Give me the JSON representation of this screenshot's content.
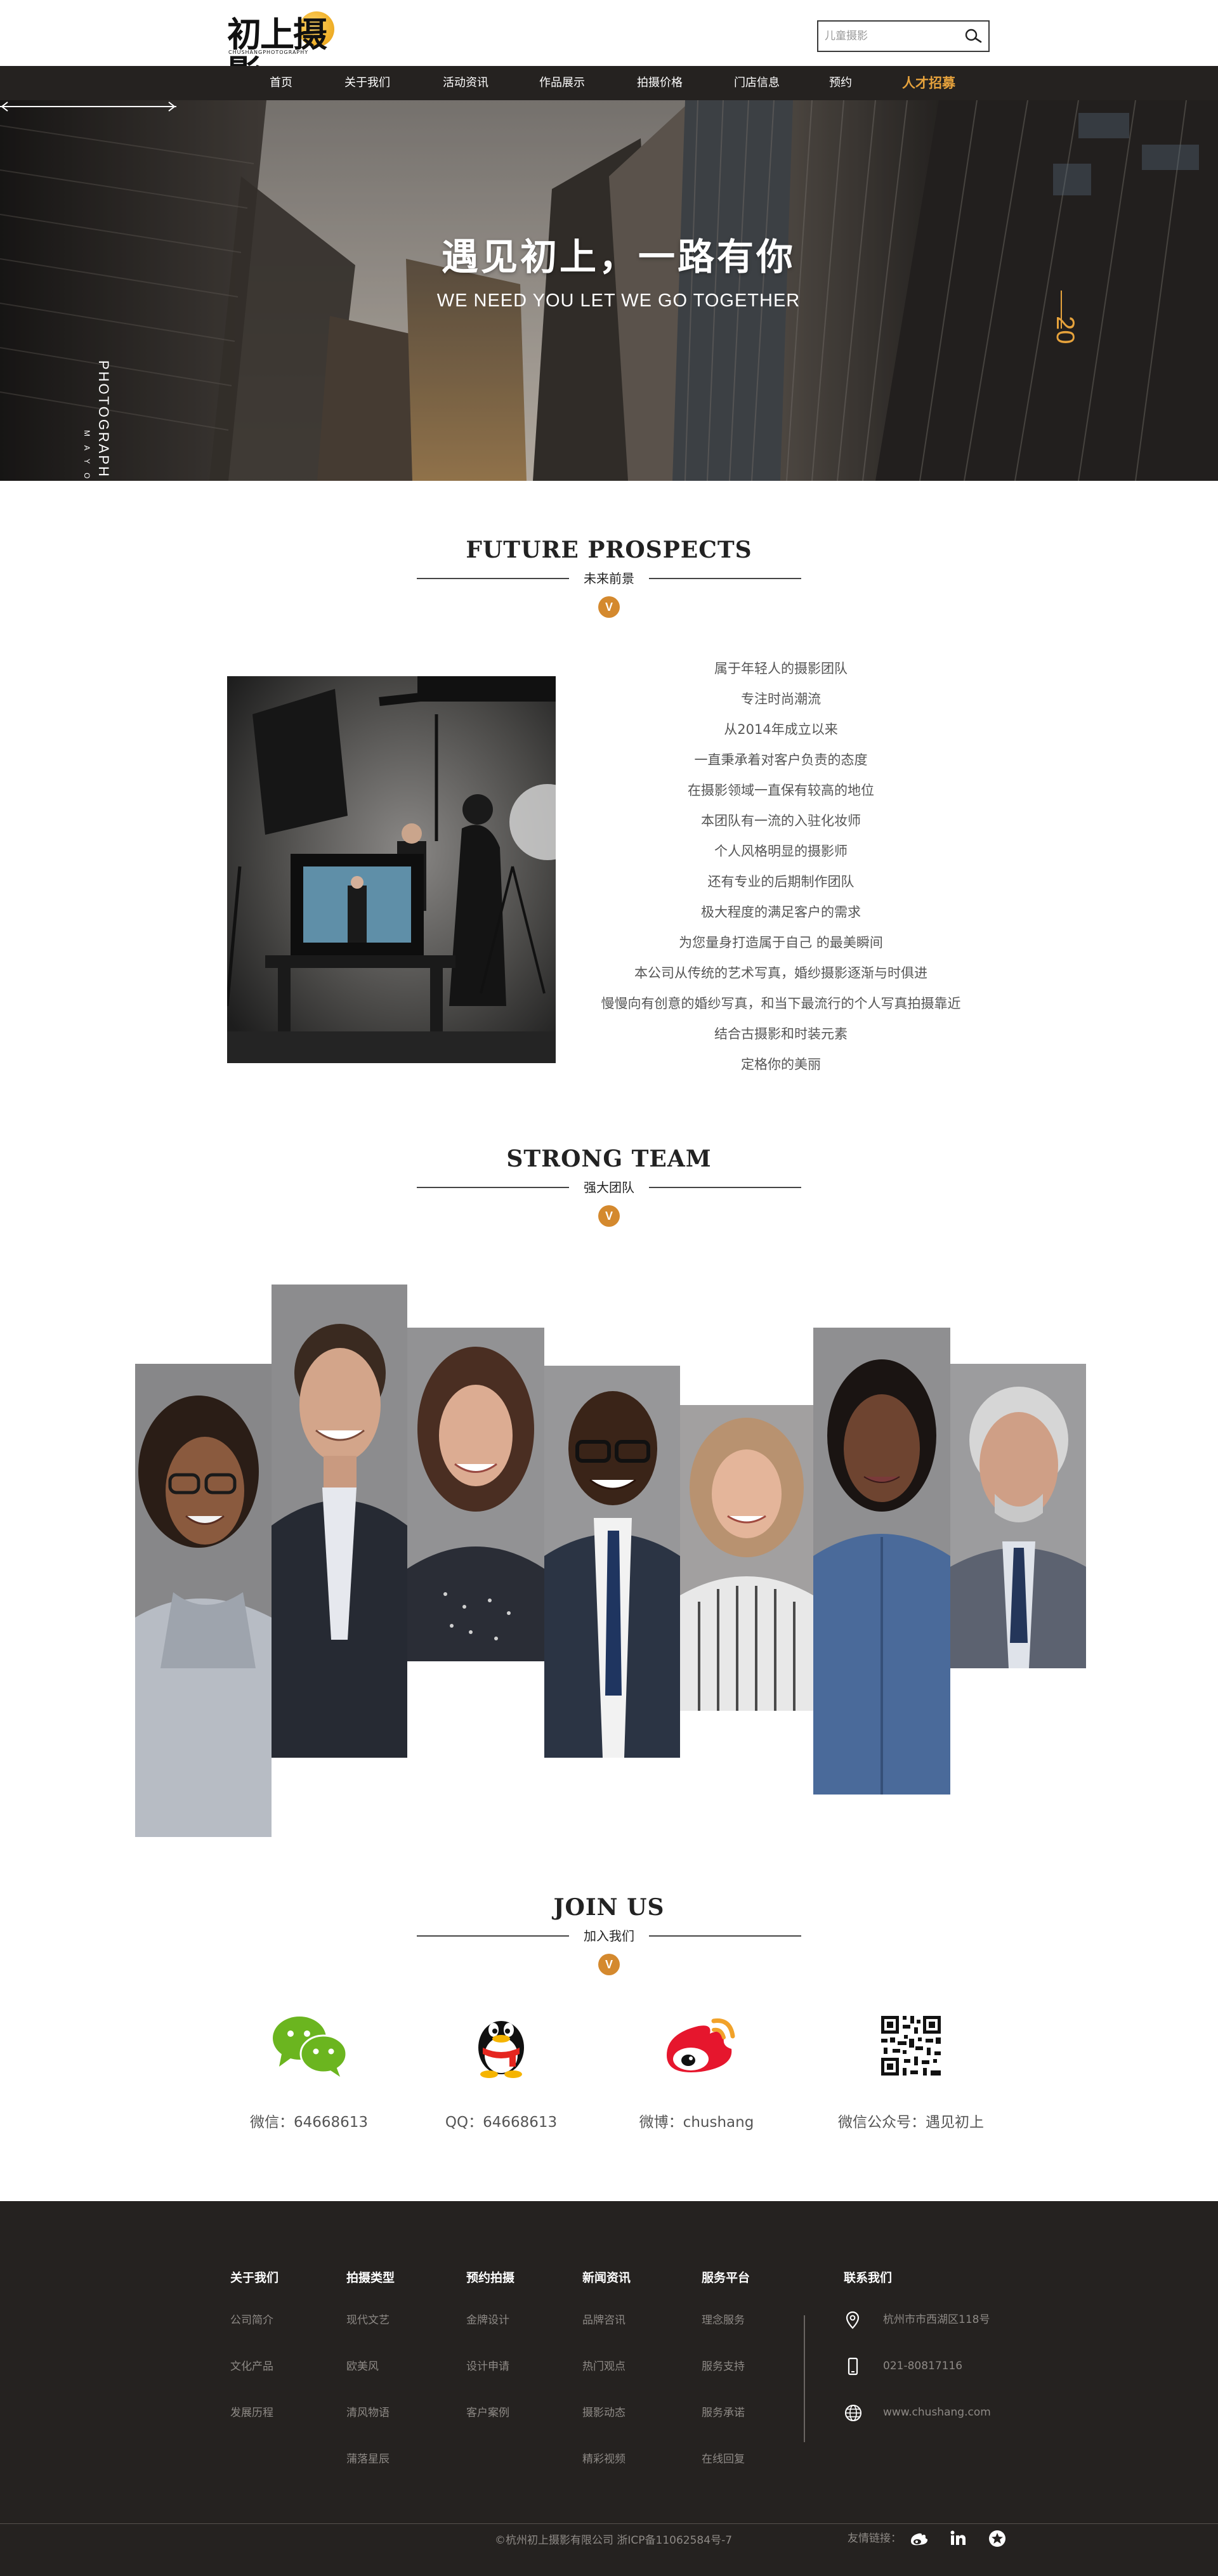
{
  "header": {
    "logo_text": "初上摄影",
    "logo_sub": "CHUSHANGPHOTOGRAPHY",
    "search_placeholder": "儿童摄影"
  },
  "nav": {
    "items": [
      "首页",
      "关于我们",
      "活动资讯",
      "作品展示",
      "拍摄价格",
      "门店信息",
      "预约",
      "人才招募"
    ]
  },
  "banner": {
    "title": "遇见初上，一路有你",
    "subtitle": "WE NEED YOU LET WE GO TOGETHER",
    "vertical_word": "PHOTOGRAPH",
    "vertical_small": "MAYOR",
    "slide_number": "20"
  },
  "prospects": {
    "title_en": "FUTURE PROSPECTS",
    "title_cn": "未来前景",
    "badge": "V",
    "lines": [
      "属于年轻人的摄影团队",
      "专注时尚潮流",
      "从2014年成立以来",
      "一直秉承着对客户负责的态度",
      "在摄影领域一直保有较高的地位",
      "本团队有一流的入驻化妆师",
      "个人风格明显的摄影师",
      "还有专业的后期制作团队",
      "极大程度的满足客户的需求",
      "为您量身打造属于自己 的最美瞬间",
      "本公司从传统的艺术写真，婚纱摄影逐渐与时俱进",
      "慢慢向有创意的婚纱写真，和当下最流行的个人写真拍摄靠近",
      "结合古摄影和时装元素",
      "定格你的美丽"
    ]
  },
  "team": {
    "title_en": "STRONG TEAM",
    "title_cn": "强大团队",
    "badge": "V"
  },
  "join": {
    "title_en": "JOIN US",
    "title_cn": "加入我们",
    "badge": "V",
    "items": [
      {
        "icon": "wechat-icon",
        "label": "微信：64668613"
      },
      {
        "icon": "qq-icon",
        "label": "QQ：64668613"
      },
      {
        "icon": "weibo-icon",
        "label": "微博：chushang"
      },
      {
        "icon": "qr-code-icon",
        "label": "微信公众号：遇见初上"
      }
    ]
  },
  "footer": {
    "columns": [
      {
        "title": "关于我们",
        "items": [
          "公司简介",
          "文化产品",
          "发展历程"
        ]
      },
      {
        "title": "拍摄类型",
        "items": [
          "现代文艺",
          "欧美风",
          "清风物语",
          "蒲落星辰"
        ]
      },
      {
        "title": "预约拍摄",
        "items": [
          "金牌设计",
          "设计申请",
          "客户案例"
        ]
      },
      {
        "title": "新闻资讯",
        "items": [
          "品牌咨讯",
          "热门观点",
          "摄影动态",
          "精彩视频"
        ]
      },
      {
        "title": "服务平台",
        "items": [
          "理念服务",
          "服务支持",
          "服务承诺",
          "在线回复"
        ]
      }
    ],
    "contact": {
      "title": "联系我们",
      "address": "杭州市市西湖区118号",
      "phone": "021-80817116",
      "website": "www.chushang.com"
    },
    "copyright": "©杭州初上摄影有限公司 浙ICP备11062584号-7",
    "links_label": "友情链接：",
    "colors": {
      "bg": "#252220",
      "accent": "#e6a23c"
    }
  }
}
